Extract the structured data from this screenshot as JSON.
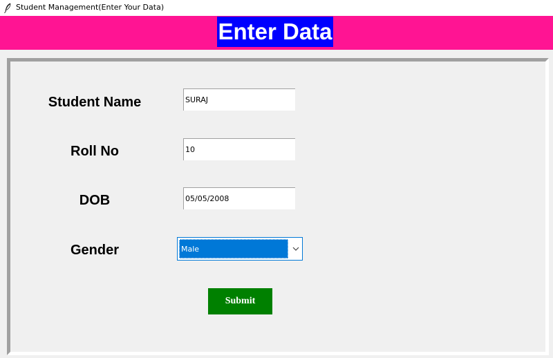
{
  "window": {
    "title": "Student Management(Enter Your Data)",
    "icon": "feather-icon"
  },
  "header": {
    "title": "Enter Data",
    "banner_color": "#ff1493",
    "title_bg_color": "#0000ff"
  },
  "form": {
    "fields": [
      {
        "label": "Student Name",
        "value": "SURAJ"
      },
      {
        "label": "Roll No",
        "value": "10"
      },
      {
        "label": "DOB",
        "value": "05/05/2008"
      }
    ],
    "gender": {
      "label": "Gender",
      "selected": "Male",
      "icon": "chevron-down-icon"
    },
    "submit_label": "Submit",
    "submit_color": "#008000"
  }
}
